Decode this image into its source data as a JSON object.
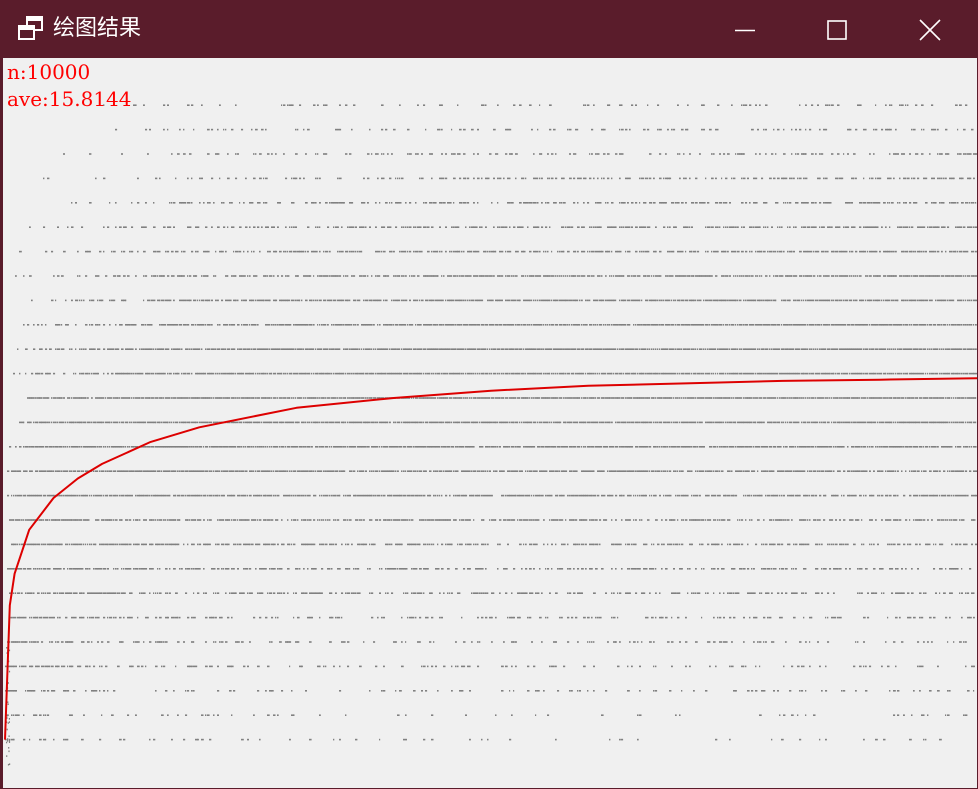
{
  "window": {
    "title": "绘图结果",
    "icon": "restore-windows-icon"
  },
  "controls": {
    "minimize_icon": "minimize-icon",
    "maximize_icon": "maximize-icon",
    "close_icon": "close-icon"
  },
  "stats": {
    "n_label": "n:10000",
    "ave_label": "ave:15.8144",
    "color": "#ff0000"
  },
  "colors": {
    "titlebar": "#5a1c2b",
    "canvas": "#f0f0f0",
    "dots": "#808080",
    "curve": "#dd0000"
  },
  "chart_data": {
    "type": "scatter",
    "title": "",
    "xlabel": "",
    "ylabel": "",
    "n": 10000,
    "average": 15.8144,
    "grid": false,
    "legend": "none",
    "series": [
      {
        "kind": "scatter",
        "color": "#808080",
        "description_of_points": "integer-valued scatter of steps for each n; values range roughly 1 to 27"
      },
      {
        "kind": "line",
        "color": "#dd0000",
        "x": [
          1,
          50,
          100,
          250,
          500,
          750,
          1000,
          1500,
          2000,
          3000,
          4000,
          5000,
          6000,
          7000,
          8000,
          9000,
          10000
        ],
        "y": [
          1.0,
          6.5,
          7.8,
          9.6,
          10.9,
          11.7,
          12.3,
          13.2,
          13.8,
          14.6,
          15.0,
          15.3,
          15.5,
          15.6,
          15.7,
          15.75,
          15.81
        ]
      }
    ],
    "xlim": [
      1,
      10000
    ],
    "ylim": [
      0,
      30
    ]
  }
}
